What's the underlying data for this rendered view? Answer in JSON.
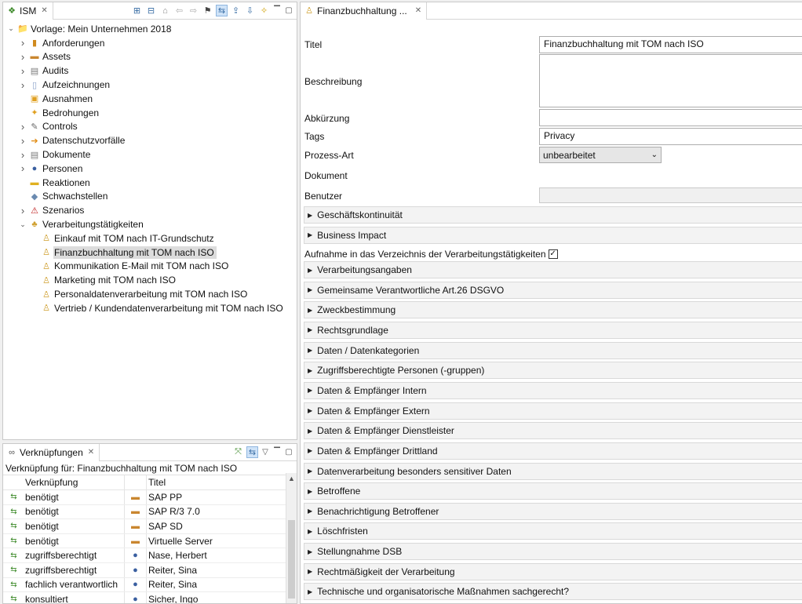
{
  "ism_panel": {
    "tab_label": "ISM",
    "tree": [
      {
        "label": "Vorlage: Mein Unternehmen 2018",
        "level": 0,
        "expander": "v",
        "icon": "folder-icon",
        "glyph": "📁",
        "color": "#6b6b6b"
      },
      {
        "label": "Anforderungen",
        "level": 1,
        "expander": ">",
        "icon": "requirements-icon",
        "glyph": "▮",
        "color": "#d08a1e"
      },
      {
        "label": "Assets",
        "level": 1,
        "expander": ">",
        "icon": "assets-icon",
        "glyph": "▬",
        "color": "#c9862f"
      },
      {
        "label": "Audits",
        "level": 1,
        "expander": ">",
        "icon": "audits-icon",
        "glyph": "▤",
        "color": "#7a7a7a"
      },
      {
        "label": "Aufzeichnungen",
        "level": 1,
        "expander": ">",
        "icon": "records-icon",
        "glyph": "▯",
        "color": "#8aa0c8"
      },
      {
        "label": "Ausnahmen",
        "level": 1,
        "expander": "",
        "icon": "exceptions-icon",
        "glyph": "▣",
        "color": "#e0a020"
      },
      {
        "label": "Bedrohungen",
        "level": 1,
        "expander": "",
        "icon": "threats-icon",
        "glyph": "✦",
        "color": "#e0a020"
      },
      {
        "label": "Controls",
        "level": 1,
        "expander": ">",
        "icon": "controls-icon",
        "glyph": "✎",
        "color": "#6a6a6a"
      },
      {
        "label": "Datenschutzvorfälle",
        "level": 1,
        "expander": ">",
        "icon": "privacy-incidents-icon",
        "glyph": "➔",
        "color": "#e08a10"
      },
      {
        "label": "Dokumente",
        "level": 1,
        "expander": ">",
        "icon": "documents-icon",
        "glyph": "▤",
        "color": "#7a7a7a"
      },
      {
        "label": "Personen",
        "level": 1,
        "expander": ">",
        "icon": "persons-icon",
        "glyph": "●",
        "color": "#3a5fa0"
      },
      {
        "label": "Reaktionen",
        "level": 1,
        "expander": "",
        "icon": "reactions-icon",
        "glyph": "▬",
        "color": "#e0b020"
      },
      {
        "label": "Schwachstellen",
        "level": 1,
        "expander": "",
        "icon": "vulnerabilities-icon",
        "glyph": "◆",
        "color": "#6a8ab0"
      },
      {
        "label": "Szenarios",
        "level": 1,
        "expander": ">",
        "icon": "warning-icon",
        "glyph": "⚠",
        "color": "#c02020"
      },
      {
        "label": "Verarbeitungstätigkeiten",
        "level": 1,
        "expander": "v",
        "icon": "processing-activities-icon",
        "glyph": "♣",
        "color": "#d0a030"
      },
      {
        "label": "Einkauf mit TOM nach IT-Grundschutz",
        "level": 2,
        "expander": "",
        "icon": "process-icon",
        "glyph": "♙",
        "color": "#d0a030"
      },
      {
        "label": "Finanzbuchhaltung  mit TOM nach ISO",
        "level": 2,
        "expander": "",
        "icon": "process-icon",
        "glyph": "♙",
        "color": "#d0a030",
        "selected": true
      },
      {
        "label": "Kommunikation  E-Mail mit TOM nach ISO",
        "level": 2,
        "expander": "",
        "icon": "process-icon",
        "glyph": "♙",
        "color": "#d0a030"
      },
      {
        "label": "Marketing mit TOM nach ISO",
        "level": 2,
        "expander": "",
        "icon": "process-icon",
        "glyph": "♙",
        "color": "#d0a030"
      },
      {
        "label": "Personaldatenverarbeitung mit TOM nach ISO",
        "level": 2,
        "expander": "",
        "icon": "process-icon",
        "glyph": "♙",
        "color": "#d0a030"
      },
      {
        "label": "Vertrieb / Kundendatenverarbeitung mit TOM nach ISO",
        "level": 2,
        "expander": "",
        "icon": "process-icon",
        "glyph": "♙",
        "color": "#d0a030"
      }
    ]
  },
  "links_panel": {
    "tab_label": "Verknüpfungen",
    "header": "Verknüpfung für: Finanzbuchhaltung  mit TOM nach ISO",
    "col_link": "Verknüpfung",
    "col_title": "Titel",
    "rows": [
      {
        "link": "benötigt",
        "title": "SAP PP",
        "type_icon": "asset-icon",
        "glyph": "▬",
        "color": "#c9862f"
      },
      {
        "link": "benötigt",
        "title": "SAP R/3 7.0",
        "type_icon": "asset-icon",
        "glyph": "▬",
        "color": "#c9862f"
      },
      {
        "link": "benötigt",
        "title": "SAP SD",
        "type_icon": "asset-icon",
        "glyph": "▬",
        "color": "#c9862f"
      },
      {
        "link": "benötigt",
        "title": "Virtuelle Server",
        "type_icon": "asset-icon",
        "glyph": "▬",
        "color": "#c9862f"
      },
      {
        "link": "zugriffsberechtigt",
        "title": "Nase, Herbert",
        "type_icon": "person-icon",
        "glyph": "●",
        "color": "#3a5fa0"
      },
      {
        "link": "zugriffsberechtigt",
        "title": "Reiter, Sina",
        "type_icon": "person-icon",
        "glyph": "●",
        "color": "#3a5fa0"
      },
      {
        "link": "fachlich verantwortlich",
        "title": "Reiter, Sina",
        "type_icon": "person-icon",
        "glyph": "●",
        "color": "#3a5fa0"
      },
      {
        "link": "konsultiert",
        "title": "Sicher, Ingo",
        "type_icon": "person-icon",
        "glyph": "●",
        "color": "#3a5fa0"
      }
    ]
  },
  "editor": {
    "tab_label": "Finanzbuchhaltung  ...",
    "fields": {
      "titel_label": "Titel",
      "titel_value": "Finanzbuchhaltung  mit TOM nach ISO",
      "beschreibung_label": "Beschreibung",
      "beschreibung_value": "",
      "abkuerzung_label": "Abkürzung",
      "abkuerzung_value": "",
      "tags_label": "Tags",
      "tags_value": "Privacy",
      "prozessart_label": "Prozess-Art",
      "prozessart_value": "unbearbeitet",
      "dokument_label": "Dokument",
      "benutzer_label": "Benutzer",
      "benutzer_value": ""
    },
    "verzeichnis_label": "Aufnahme in das Verzeichnis der Verarbeitungstätigkeiten",
    "verzeichnis_checked": "✓",
    "sections_top": [
      "Geschäftskontinuität",
      "Business Impact"
    ],
    "sections": [
      "Verarbeitungsangaben",
      "Gemeinsame Verantwortliche Art.26 DSGVO",
      "Zweckbestimmung",
      "Rechtsgrundlage",
      "Daten / Datenkategorien",
      "Zugriffsberechtigte Personen (-gruppen)",
      "Daten & Empfänger Intern",
      "Daten & Empfänger Extern",
      "Daten & Empfänger Dienstleister",
      "Daten & Empfänger Drittland",
      "Datenverarbeitung besonders sensitiver Daten",
      "Betroffene",
      "Benachrichtigung Betroffener",
      "Löschfristen",
      "Stellungnahme DSB",
      "Rechtmäßigkeit der Verarbeitung",
      "Technische und organisatorische Maßnahmen sachgerecht?"
    ]
  }
}
